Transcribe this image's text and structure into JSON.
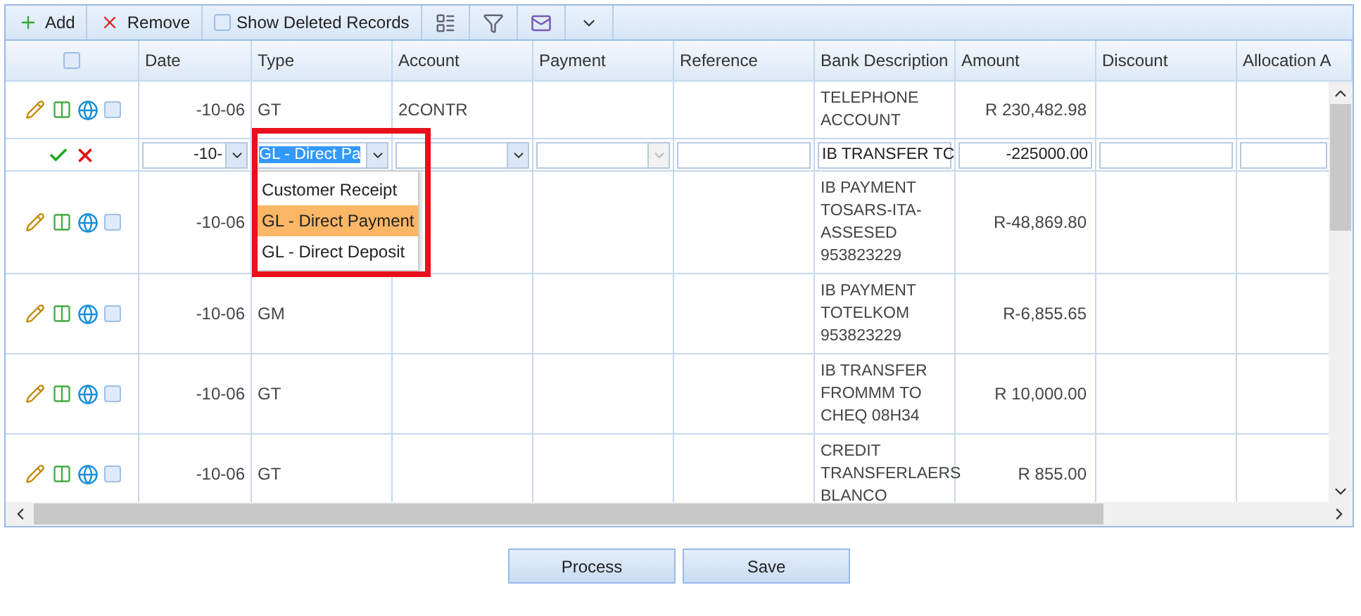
{
  "toolbar": {
    "add": {
      "label": "Add"
    },
    "remove": {
      "label": "Remove"
    },
    "show_deleted": {
      "label": "Show Deleted Records",
      "checked": false
    }
  },
  "grid": {
    "header_checkbox": {
      "checked": false
    },
    "columns": [
      "Date",
      "Type",
      "Account",
      "Payment",
      "Reference",
      "Bank Description",
      "Amount",
      "Discount",
      "Allocation A"
    ],
    "rows": [
      {
        "kind": "data",
        "checked": false,
        "date": "-10-06",
        "type": "GT",
        "account": "2CONTR",
        "bank_description": [
          "TELEPHONE",
          "ACCOUNT"
        ],
        "amount": "R 230,482.98"
      },
      {
        "kind": "edit",
        "date": "-10-",
        "type": "GL - Direct Pa",
        "type_open": true,
        "account": "",
        "payment_disabled": true,
        "bank_description": "IB TRANSFER TC",
        "amount": "-225000.00"
      },
      {
        "kind": "data",
        "checked": false,
        "date": "-10-06",
        "type": "",
        "account": "",
        "bank_description": [
          "IB PAYMENT",
          "TOSARS-ITA-",
          "ASSESED",
          "953823229"
        ],
        "amount": "R-48,869.80"
      },
      {
        "kind": "data",
        "checked": false,
        "date": "-10-06",
        "type": "GM",
        "account": "",
        "bank_description": [
          "IB PAYMENT",
          "TOTELKOM",
          "953823229"
        ],
        "amount": "R-6,855.65"
      },
      {
        "kind": "data",
        "checked": false,
        "date": "-10-06",
        "type": "GT",
        "account": "",
        "bank_description": [
          "IB TRANSFER",
          "FROMMM TO",
          "CHEQ 08H34"
        ],
        "amount": "R 10,000.00"
      },
      {
        "kind": "data",
        "checked": false,
        "date": "-10-06",
        "type": "GT",
        "account": "",
        "bank_description": [
          "CREDIT",
          "TRANSFERLAERS",
          "BLANCO"
        ],
        "amount": "R 855.00"
      }
    ],
    "type_options": [
      {
        "label": "Customer Receipt",
        "selected": false
      },
      {
        "label": "GL - Direct Payment",
        "selected": true
      },
      {
        "label": "GL - Direct Deposit",
        "selected": false
      }
    ]
  },
  "buttons": [
    "Process",
    "Save"
  ]
}
